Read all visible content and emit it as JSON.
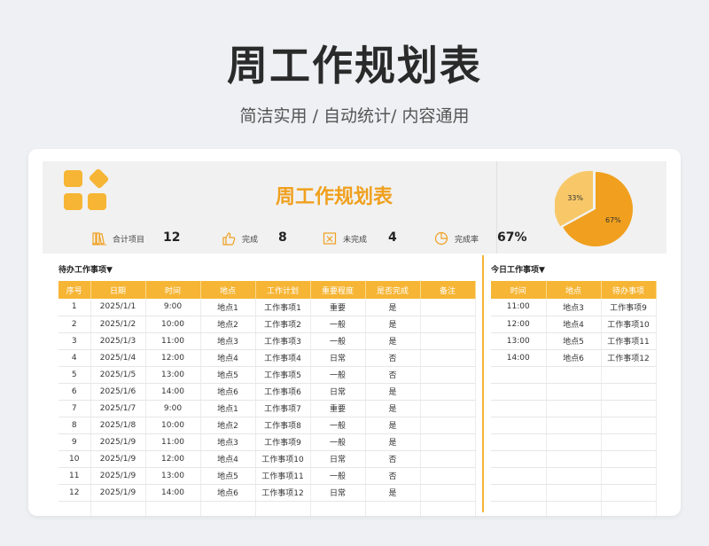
{
  "hero": {
    "title": "周工作规划表",
    "subtitle": "简洁实用 / 自动统计/ 内容通用"
  },
  "header": {
    "title": "周工作规划表",
    "stats": [
      {
        "icon": "books-icon",
        "label": "合计项目",
        "value": "12"
      },
      {
        "icon": "thumbs-up-icon",
        "label": "完成",
        "value": "8"
      },
      {
        "icon": "cancel-box-icon",
        "label": "未完成",
        "value": "4"
      },
      {
        "icon": "pie-chart-icon",
        "label": "完成率",
        "value": "67%"
      }
    ],
    "pie": {
      "done_label": "67%",
      "undone_label": "33%",
      "done_fraction": 0.67,
      "done_color": "#f0a01e",
      "undone_color": "#f8c868"
    }
  },
  "todo": {
    "section_label": "待办工作事项▼",
    "columns": [
      "序号",
      "日期",
      "时间",
      "地点",
      "工作计划",
      "重要程度",
      "是否完成",
      "备注"
    ],
    "rows": [
      [
        "1",
        "2025/1/1",
        "9:00",
        "地点1",
        "工作事项1",
        "重要",
        "是",
        ""
      ],
      [
        "2",
        "2025/1/2",
        "10:00",
        "地点2",
        "工作事项2",
        "一般",
        "是",
        ""
      ],
      [
        "3",
        "2025/1/3",
        "11:00",
        "地点3",
        "工作事项3",
        "一般",
        "是",
        ""
      ],
      [
        "4",
        "2025/1/4",
        "12:00",
        "地点4",
        "工作事项4",
        "日常",
        "否",
        ""
      ],
      [
        "5",
        "2025/1/5",
        "13:00",
        "地点5",
        "工作事项5",
        "一般",
        "否",
        ""
      ],
      [
        "6",
        "2025/1/6",
        "14:00",
        "地点6",
        "工作事项6",
        "日常",
        "是",
        ""
      ],
      [
        "7",
        "2025/1/7",
        "9:00",
        "地点1",
        "工作事项7",
        "重要",
        "是",
        ""
      ],
      [
        "8",
        "2025/1/8",
        "10:00",
        "地点2",
        "工作事项8",
        "一般",
        "是",
        ""
      ],
      [
        "9",
        "2025/1/9",
        "11:00",
        "地点3",
        "工作事项9",
        "一般",
        "是",
        ""
      ],
      [
        "10",
        "2025/1/9",
        "12:00",
        "地点4",
        "工作事项10",
        "日常",
        "否",
        ""
      ],
      [
        "11",
        "2025/1/9",
        "13:00",
        "地点5",
        "工作事项11",
        "一般",
        "否",
        ""
      ],
      [
        "12",
        "2025/1/9",
        "14:00",
        "地点6",
        "工作事项12",
        "日常",
        "是",
        ""
      ]
    ]
  },
  "today": {
    "section_label": "今日工作事项▼",
    "columns": [
      "时间",
      "地点",
      "待办事项"
    ],
    "rows": [
      [
        "11:00",
        "地点3",
        "工作事项9"
      ],
      [
        "12:00",
        "地点4",
        "工作事项10"
      ],
      [
        "13:00",
        "地点5",
        "工作事项11"
      ],
      [
        "14:00",
        "地点6",
        "工作事项12"
      ]
    ]
  },
  "colors": {
    "accent": "#f6b534",
    "title": "#f0a01e"
  }
}
